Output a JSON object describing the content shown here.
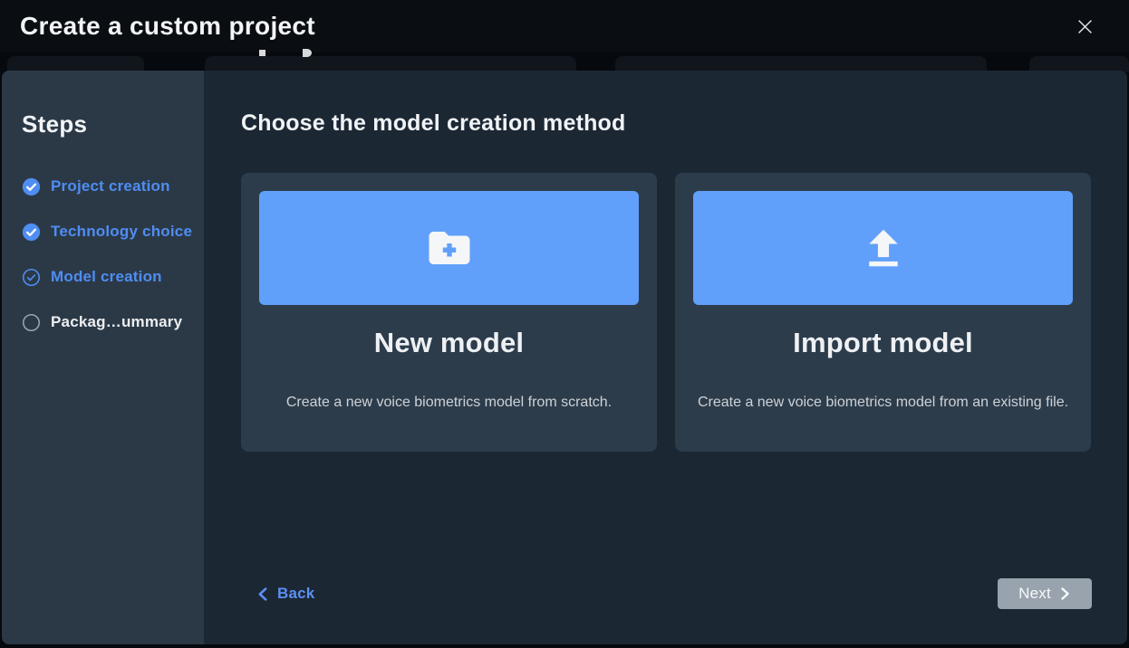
{
  "modal": {
    "title": "Create a custom project",
    "close_icon": "close-icon"
  },
  "sidebar": {
    "title": "Steps",
    "steps": [
      {
        "label": "Project creation",
        "state": "completed",
        "icon": "check-circle-filled-icon"
      },
      {
        "label": "Technology choice",
        "state": "completed",
        "icon": "check-circle-filled-icon"
      },
      {
        "label": "Model creation",
        "state": "current",
        "icon": "check-circle-outline-icon"
      },
      {
        "label": "Packag…ummary",
        "state": "pending",
        "icon": "circle-outline-icon"
      }
    ]
  },
  "content": {
    "heading": "Choose the model creation method",
    "cards": [
      {
        "title": "New model",
        "description": "Create a new voice biometrics model from scratch.",
        "icon": "folder-plus-icon"
      },
      {
        "title": "Import model",
        "description": "Create a new voice biometrics model from an existing file.",
        "icon": "upload-icon"
      }
    ]
  },
  "footer": {
    "back_label": "Back",
    "next_label": "Next",
    "next_enabled": false
  },
  "colors": {
    "accent_blue": "#61a0fa",
    "step_link_blue": "#4f8df2",
    "back_link_blue": "#5b8ff2",
    "disabled_button_gray": "#98a3ad",
    "sidebar_bg": "#2b3947",
    "content_bg": "#1c2734",
    "card_bg": "#2d3c4b",
    "header_bg": "#0a0e13"
  }
}
